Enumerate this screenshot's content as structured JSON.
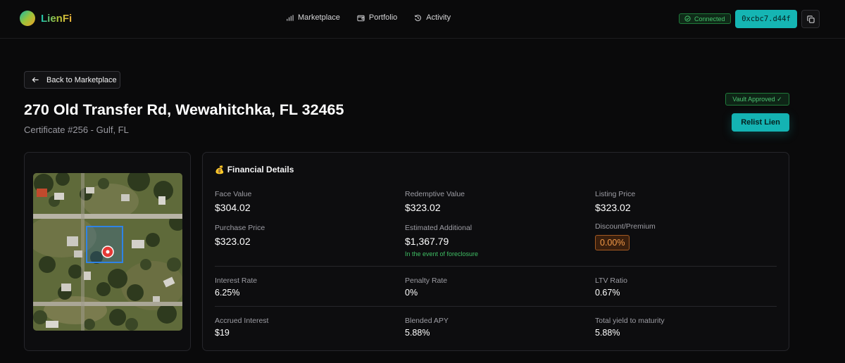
{
  "nav": {
    "brand": "LienFi",
    "links": [
      {
        "label": "Marketplace",
        "icon": "bar-chart-icon"
      },
      {
        "label": "Portfolio",
        "icon": "wallet-icon"
      },
      {
        "label": "Activity",
        "icon": "history-icon"
      }
    ],
    "status": "Connected",
    "wallet_address": "0xcbc7.d44f"
  },
  "header": {
    "back_label": "Back to Marketplace",
    "title": "270 Old Transfer Rd, Wewahitchka, FL 32465",
    "subtitle": "Certificate #256 - Gulf, FL",
    "vault_badge": "Vault Approved ✓",
    "relist_label": "Relist Lien"
  },
  "financial": {
    "title": "Financial Details",
    "face_value": {
      "label": "Face Value",
      "value": "$304.02"
    },
    "redemptive_value": {
      "label": "Redemptive Value",
      "value": "$323.02"
    },
    "listing_price": {
      "label": "Listing Price",
      "value": "$323.02"
    },
    "purchase_price": {
      "label": "Purchase Price",
      "value": "$323.02"
    },
    "estimated_additional": {
      "label": "Estimated Additional",
      "value": "$1,367.79",
      "note": "In the event of foreclosure"
    },
    "discount_premium": {
      "label": "Discount/Premium",
      "value": "0.00%"
    },
    "interest_rate": {
      "label": "Interest Rate",
      "value": "6.25%"
    },
    "penalty_rate": {
      "label": "Penalty Rate",
      "value": "0%"
    },
    "ltv_ratio": {
      "label": "LTV Ratio",
      "value": "0.67%"
    },
    "accrued_interest": {
      "label": "Accrued Interest",
      "value": "$19"
    },
    "blended_apy": {
      "label": "Blended APY",
      "value": "5.88%"
    },
    "total_yield": {
      "label": "Total yield to maturity",
      "value": "5.88%"
    }
  },
  "colors": {
    "accent": "#14b3b3",
    "connected": "#46c26c",
    "discount": "#f39a48",
    "background": "#0a0a0b"
  }
}
